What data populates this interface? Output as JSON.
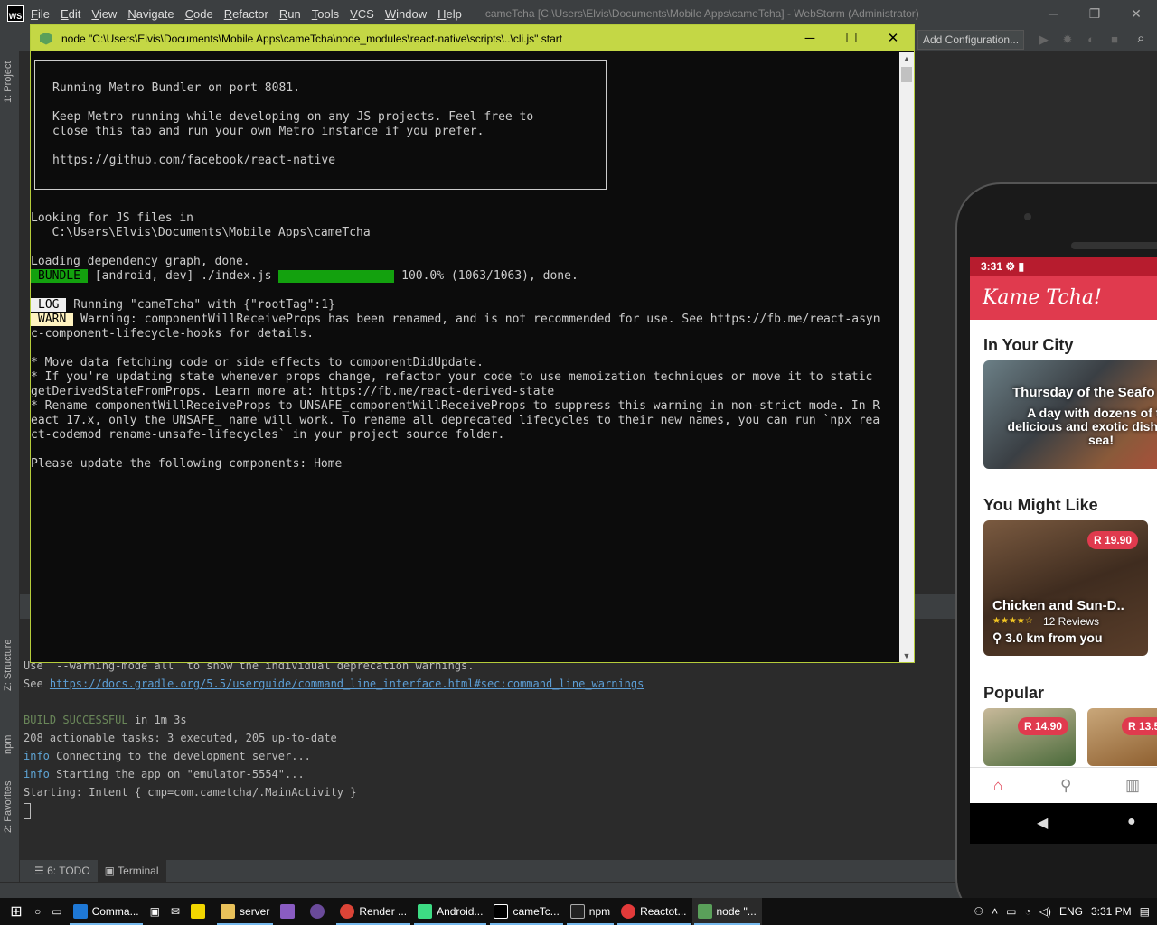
{
  "ide": {
    "menu": [
      "File",
      "Edit",
      "View",
      "Navigate",
      "Code",
      "Refactor",
      "Run",
      "Tools",
      "VCS",
      "Window",
      "Help"
    ],
    "title": "cameTcha [C:\\Users\\Elvis\\Documents\\Mobile Apps\\cameTcha] - WebStorm (Administrator)",
    "add_configuration": "Add Configuration...",
    "left_tabs": {
      "project": "1: Project",
      "structure": "Z: Structure",
      "npm": "npm",
      "favorites": "2: Favorites"
    },
    "console_lines": [
      "Use `--warning-mode all` to show the individual deprecation warnings.",
      "See ",
      "https://docs.gradle.org/5.5/userguide/command_line_interface.html#sec:command_line_warnings",
      "BUILD SUCCESSFUL",
      " in 1m 3s",
      "208 actionable tasks: 3 executed, 205 up-to-date",
      "info",
      " Connecting to the development server...",
      " Starting the app on \"emulator-5554\"...",
      "Starting: Intent { cmp=com.cametcha/.MainActivity }"
    ],
    "bottom_tabs": {
      "todo": "6: TODO",
      "terminal": "Terminal"
    }
  },
  "node_window": {
    "title": "node  \"C:\\Users\\Elvis\\Documents\\Mobile Apps\\cameTcha\\node_modules\\react-native\\scripts\\..\\cli.js\" start",
    "box_lines": [
      "Running Metro Bundler on port 8081.",
      "Keep Metro running while developing on any JS projects. Feel free to",
      "close this tab and run your own Metro instance if you prefer.",
      "https://github.com/facebook/react-native"
    ],
    "looking": "Looking for JS files in",
    "path": "   C:\\Users\\Elvis\\Documents\\Mobile Apps\\cameTcha",
    "loading": "Loading dependency graph, done.",
    "bundle_badge": "BUNDLE",
    "bundle_text": " [android, dev] ./index.js ",
    "bundle_done": " 100.0% (1063/1063), done.",
    "bundle_progress": 1.0,
    "log_badge": "LOG",
    "log_text": " Running \"cameTcha\" with {\"rootTag\":1}",
    "warn_badge": "WARN",
    "warn_text": " Warning: componentWillReceiveProps has been renamed, and is not recommended for use. See https://fb.me/react-asyn",
    "warn_cont": "c-component-lifecycle-hooks for details.",
    "bullets": [
      "* Move data fetching code or side effects to componentDidUpdate.",
      "* If you're updating state whenever props change, refactor your code to use memoization techniques or move it to static",
      "getDerivedStateFromProps. Learn more at: https://fb.me/react-derived-state",
      "* Rename componentWillReceiveProps to UNSAFE_componentWillReceiveProps to suppress this warning in non-strict mode. In R",
      "eact 17.x, only the UNSAFE_ name will work. To rename all deprecated lifecycles to their new names, you can run `npx rea",
      "ct-codemod rename-unsafe-lifecycles` in your project source folder."
    ],
    "please": "Please update the following components: Home"
  },
  "phone": {
    "time": "3:31",
    "app_title": "Kame Tcha!",
    "section_city": "In Your City",
    "city_card_title": "Thursday of the Seafo",
    "city_card_sub": "A day with dozens of the delicious and exotic dishes the sea!",
    "section_like": "You Might Like",
    "like_price": "R 19.90",
    "like_name": "Chicken and Sun-D..",
    "like_stars": "★★★★☆",
    "like_reviews": "12 Reviews",
    "like_dist": "3.0 km from you",
    "section_popular": "Popular",
    "pop_price_1": "R 14.90",
    "pop_price_2": "R 13.5"
  },
  "taskbar": {
    "items": [
      "Comma...",
      "server",
      "Render ...",
      "Android...",
      "cameTc...",
      "npm",
      "Reactot...",
      "node \"..."
    ],
    "lang": "ENG",
    "time": "3:31 PM"
  }
}
